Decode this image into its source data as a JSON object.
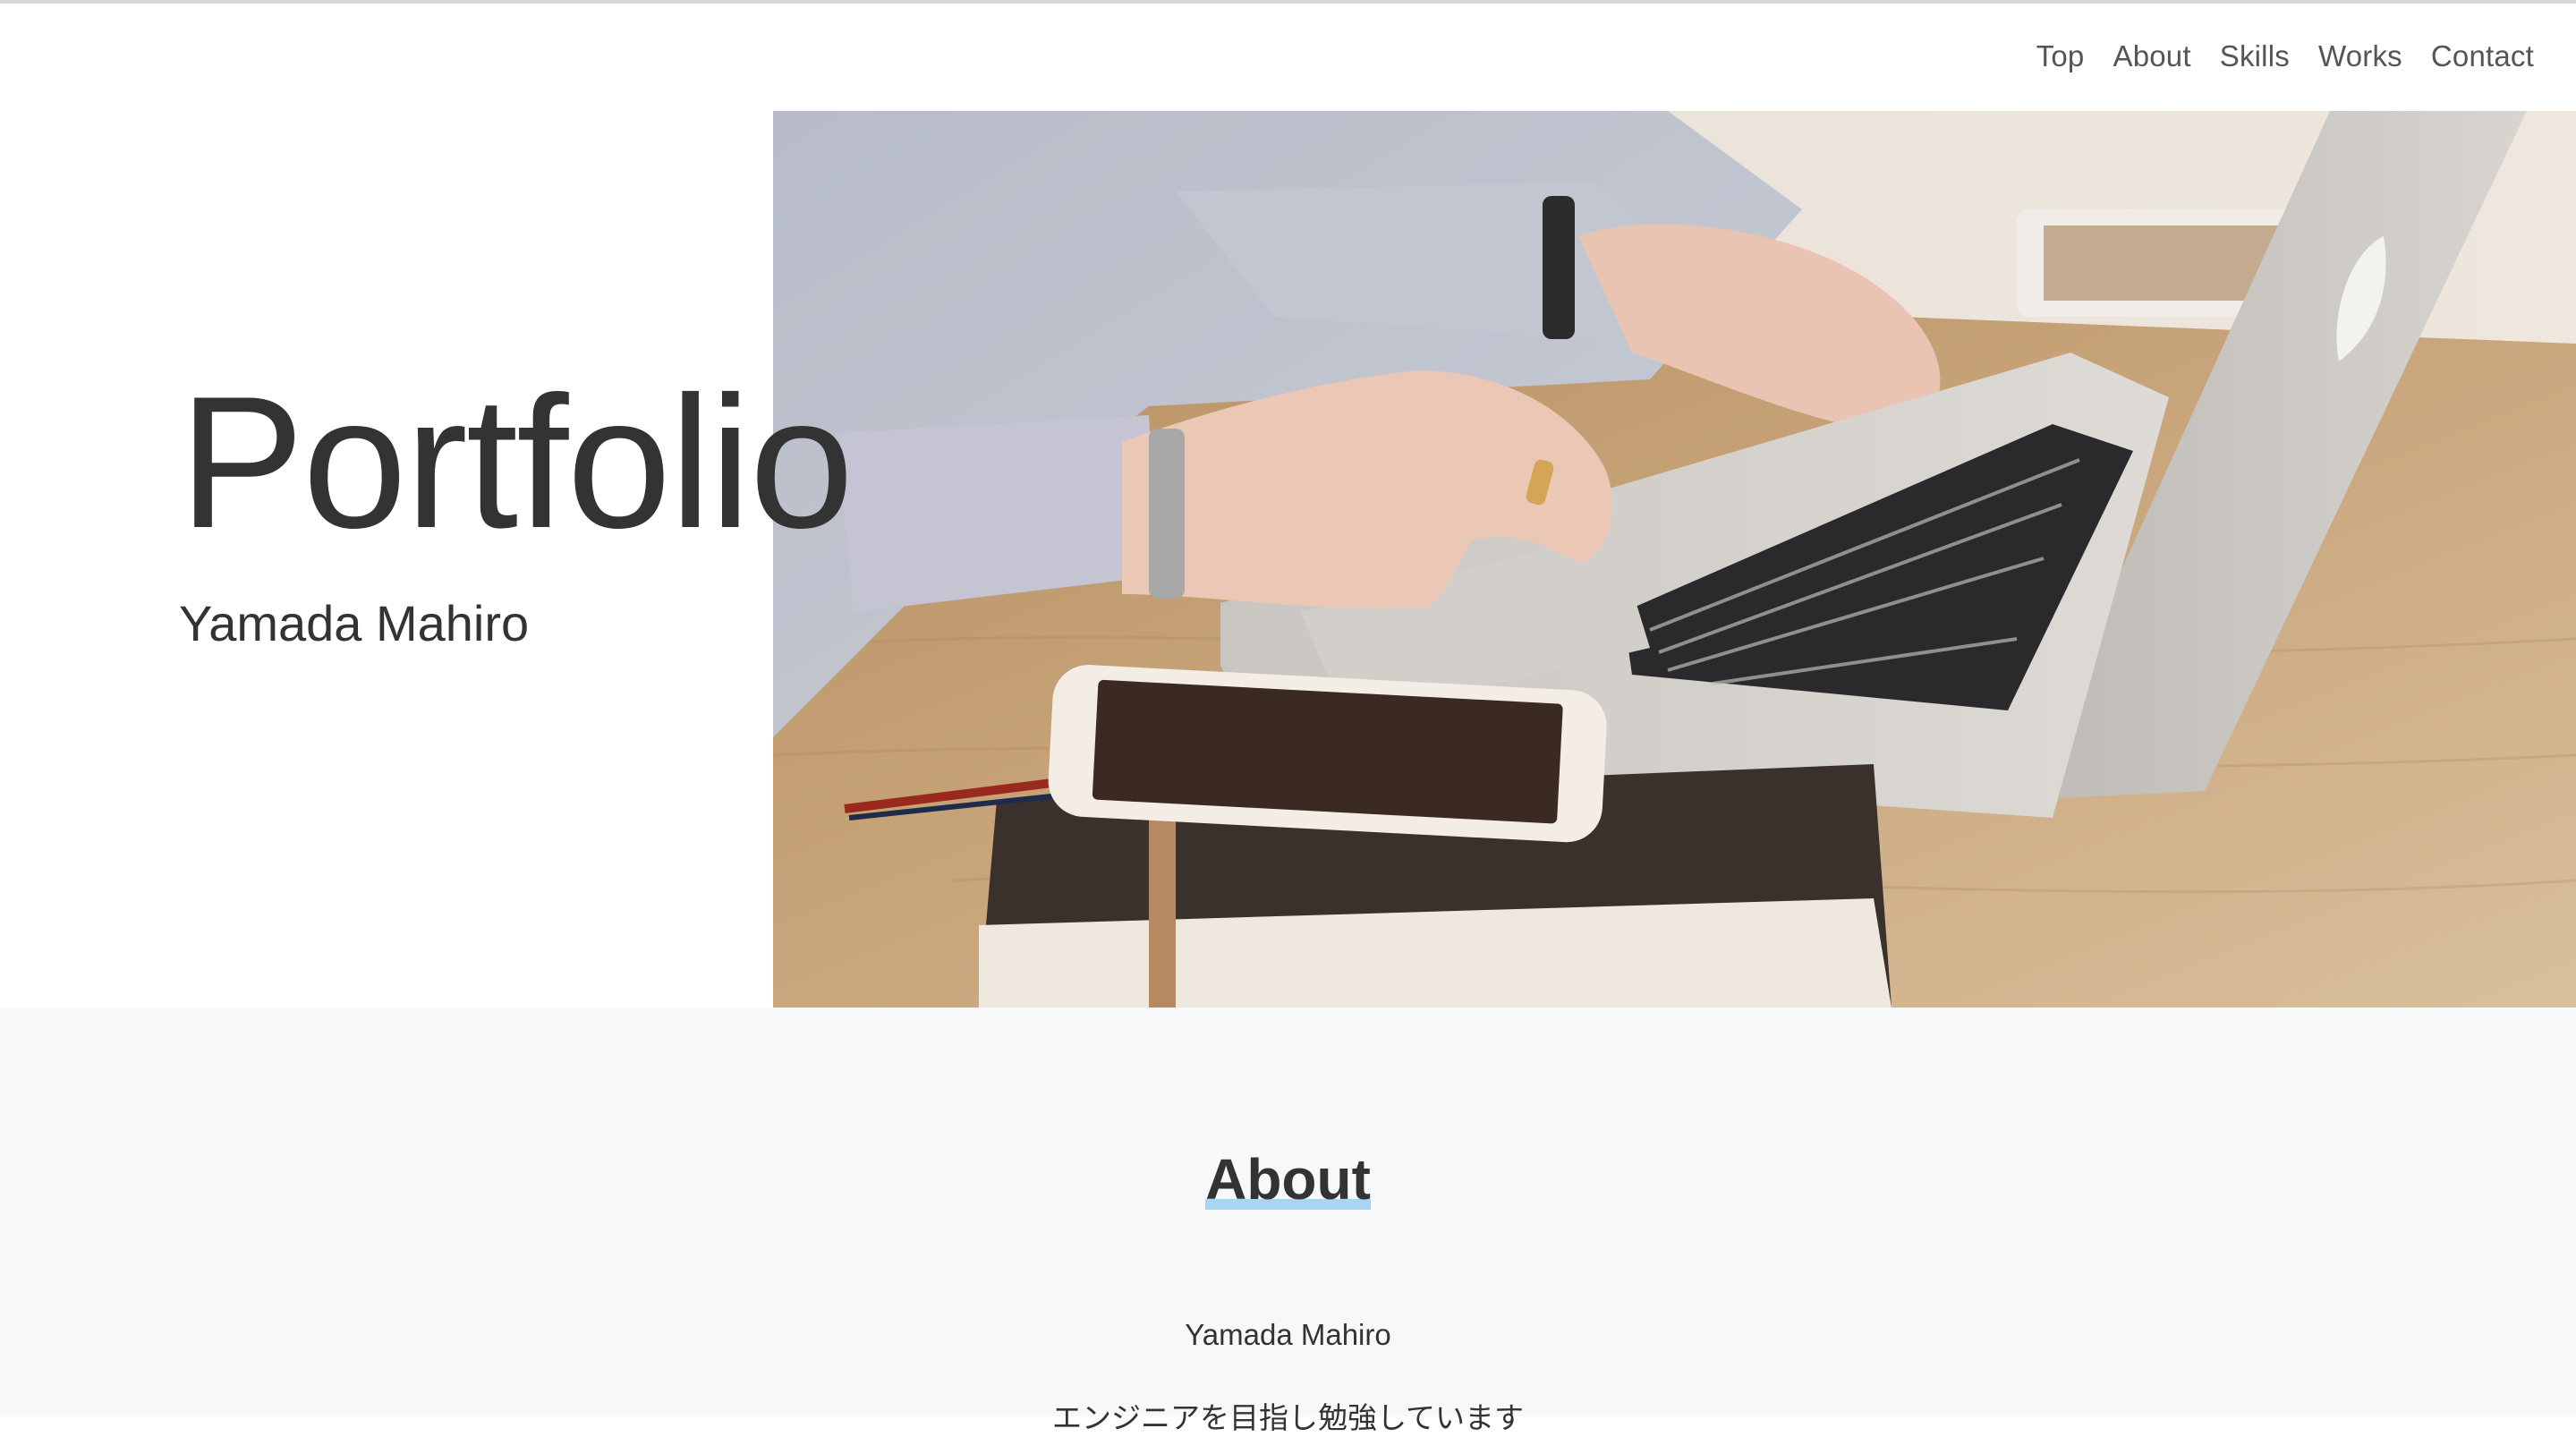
{
  "nav": {
    "items": [
      {
        "label": "Top"
      },
      {
        "label": "About"
      },
      {
        "label": "Skills"
      },
      {
        "label": "Works"
      },
      {
        "label": "Contact"
      }
    ]
  },
  "hero": {
    "title": "Portfolio",
    "name": "Yamada Mahiro",
    "image": "laptop-desk-photo"
  },
  "about": {
    "heading": "About",
    "name": "Yamada Mahiro",
    "description": "エンジニアを目指し勉強しています"
  },
  "colors": {
    "text": "#333333",
    "nav_text": "#555555",
    "about_bg": "#f7f8fa",
    "heading_underline": "#a8d6f2"
  }
}
